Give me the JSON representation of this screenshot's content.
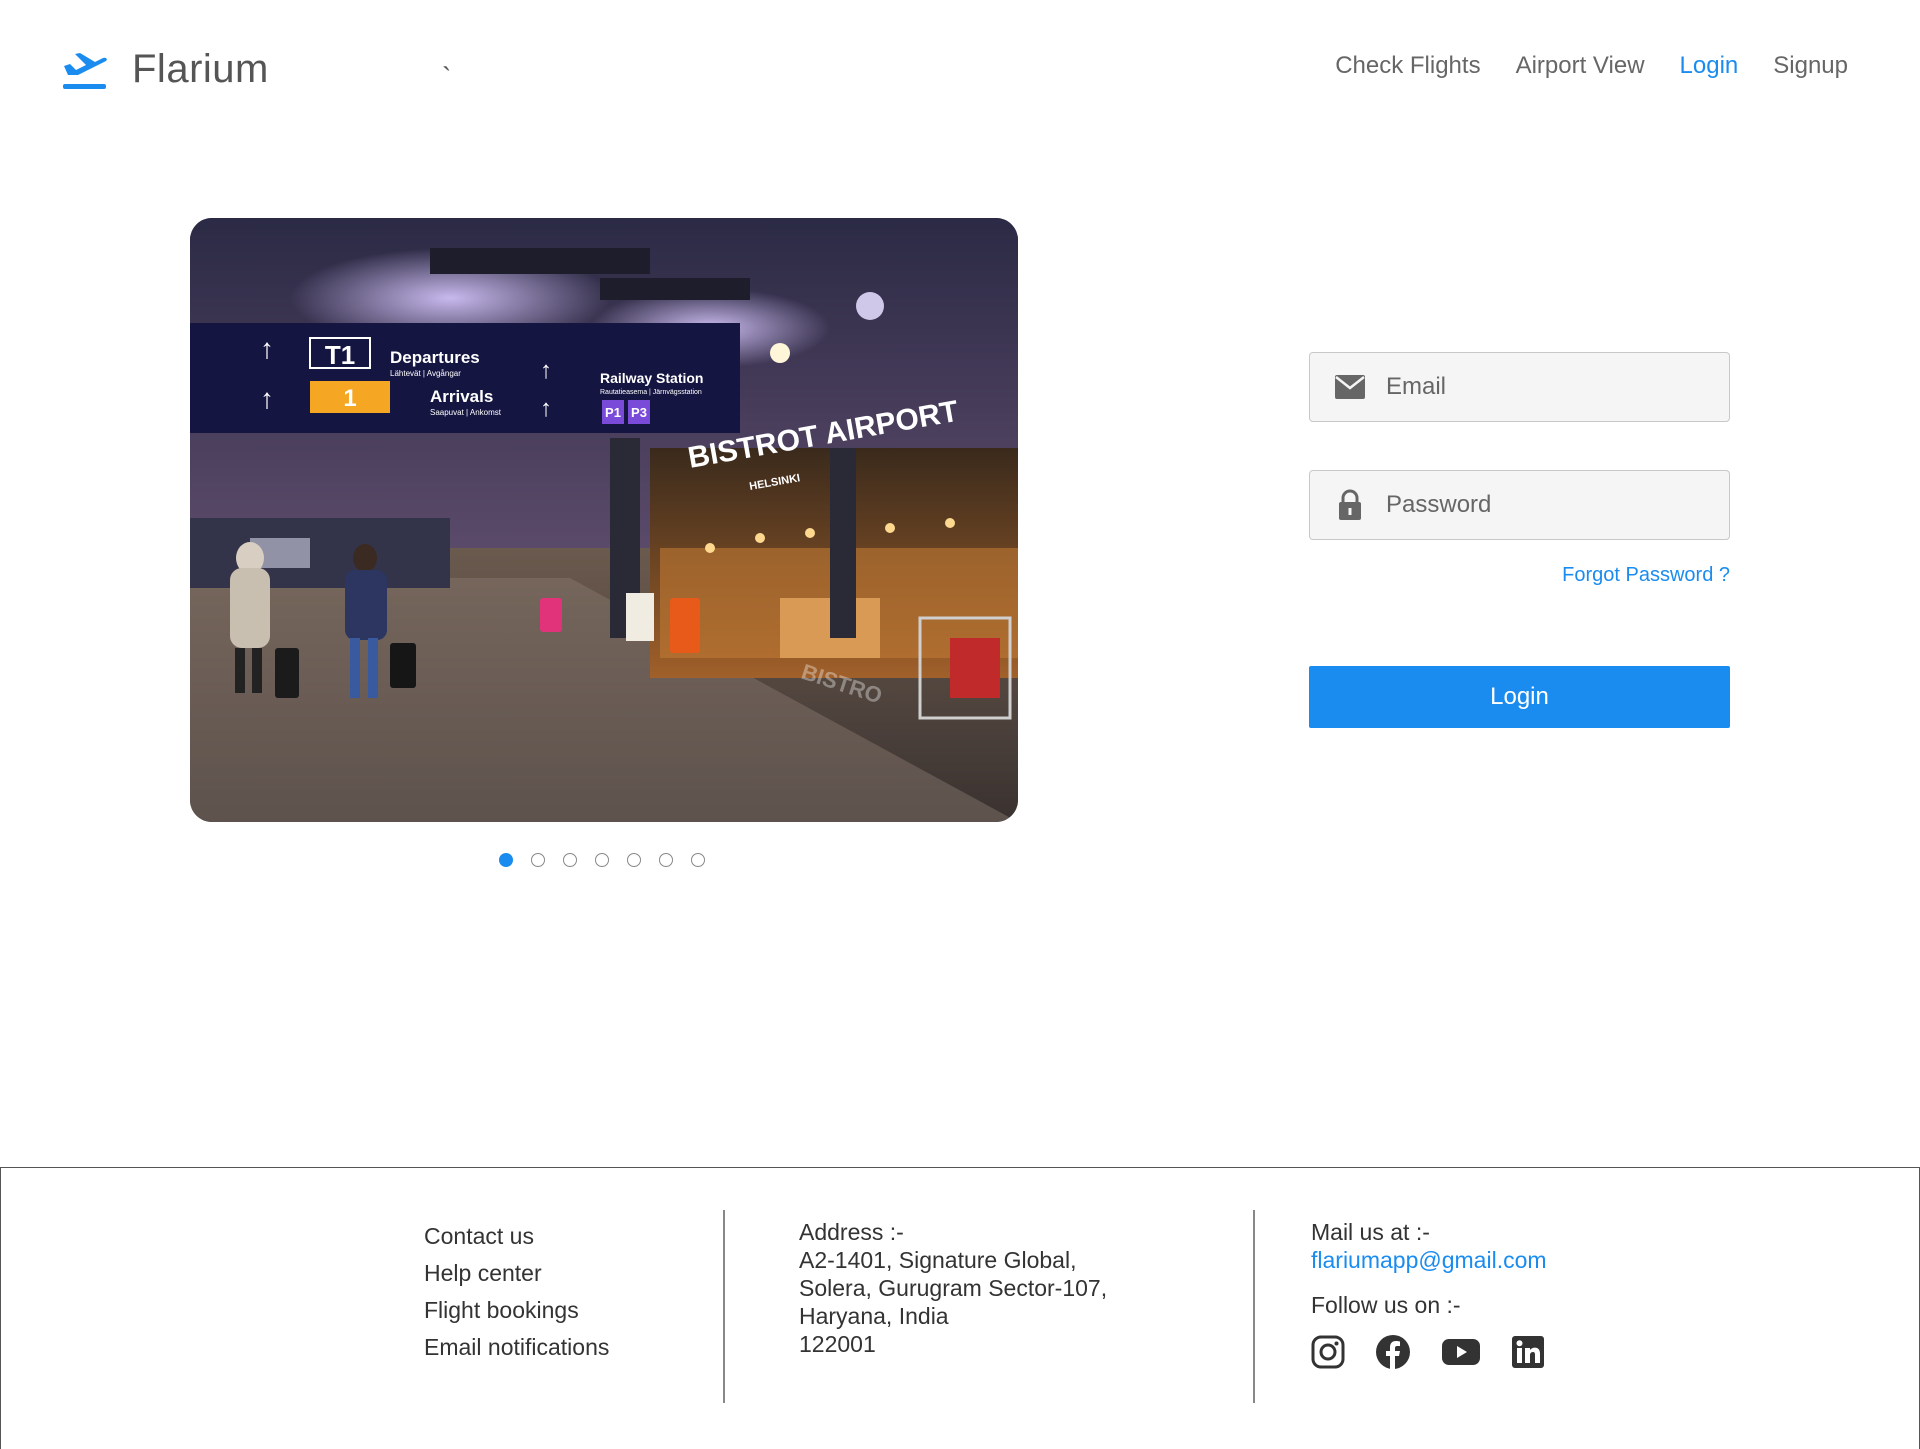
{
  "brand": {
    "name": "Flarium",
    "logo_icon": "plane-takeoff-icon",
    "stray_mark": "`",
    "accent_color": "#1a8cf0"
  },
  "nav": {
    "items": [
      {
        "label": "Check Flights",
        "active": false
      },
      {
        "label": "Airport View",
        "active": false
      },
      {
        "label": "Login",
        "active": true
      },
      {
        "label": "Signup",
        "active": false
      }
    ]
  },
  "carousel": {
    "image": {
      "sign_departures": "Departures",
      "sign_departures_sub": "Lähtevät | Avgångar",
      "sign_arrivals": "Arrivals",
      "sign_arrivals_sub": "Saapuvat | Ankomst",
      "sign_terminal": "T1",
      "sign_gate": "1",
      "sign_railway": "Railway Station",
      "sign_railway_sub": "Rautatieasema | Järnvägsstation",
      "sign_p1": "P1",
      "sign_p3": "P3",
      "bistro_name": "BISTROT AIRPORT",
      "bistro_city": "HELSINKI",
      "floor_text": "BISTRO"
    },
    "slide_count": 7,
    "active_index": 0
  },
  "login_form": {
    "email_placeholder": "Email",
    "email_icon": "envelope-icon",
    "password_placeholder": "Password",
    "password_icon": "lock-icon",
    "forgot_label": "Forgot Password ?",
    "submit_label": "Login"
  },
  "footer": {
    "links": [
      "Contact us",
      "Help center",
      "Flight bookings",
      "Email notifications"
    ],
    "address_title": "Address :-",
    "address_lines": [
      "A2-1401, Signature Global,",
      "Solera, Gurugram Sector-107,",
      "Haryana, India",
      "122001"
    ],
    "mail_title": "Mail us at :-",
    "mail_address": "flariumapp@gmail.com",
    "follow_title": "Follow us on :-",
    "socials": [
      "instagram-icon",
      "facebook-icon",
      "youtube-icon",
      "linkedin-icon"
    ]
  }
}
